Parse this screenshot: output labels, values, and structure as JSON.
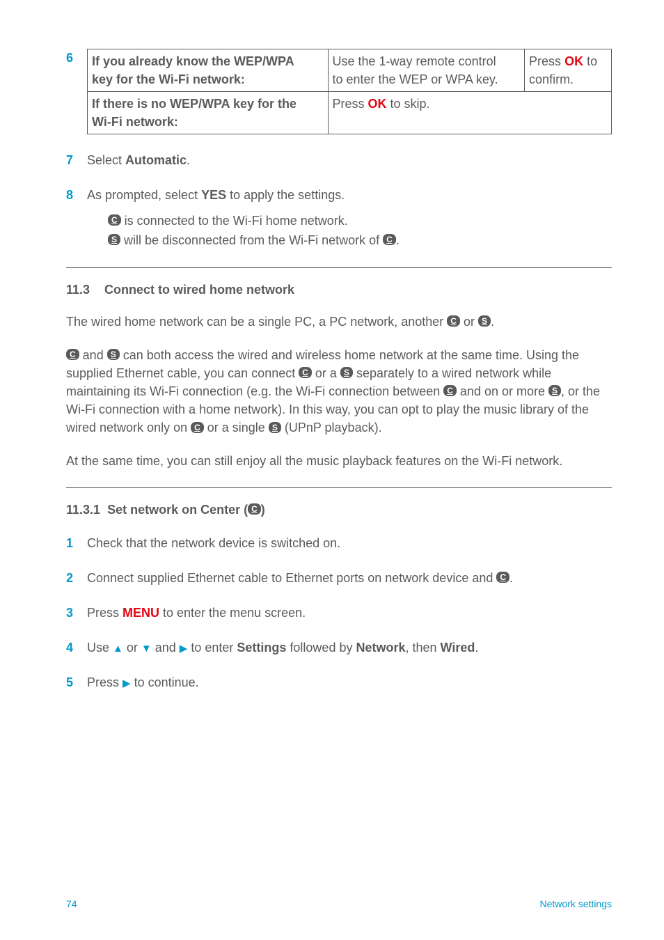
{
  "step6": {
    "num": "6",
    "row1c1a": "If you already know the WEP/WPA",
    "row1c1b": "key for the Wi-Fi network:",
    "row1c2a": "Use the 1-way remote control",
    "row1c2b": "to enter the WEP or WPA key.",
    "row1c3a": "Press ",
    "row1c3ok": "OK",
    "row1c3b": " to",
    "row1c3c": "confirm.",
    "row2c1a": "If there is no WEP/WPA key for the",
    "row2c1b": "Wi-Fi network:",
    "row2c2a": "Press ",
    "row2c2ok": "OK",
    "row2c2b": " to skip."
  },
  "step7": {
    "num": "7",
    "a": "Select ",
    "b": "Automatic",
    "c": "."
  },
  "step8": {
    "num": "8",
    "a": "As prompted, select ",
    "b": "YES",
    "c": " to apply the settings.",
    "line1a": " is connected to the Wi-Fi home network.",
    "line2a": " will be disconnected from the Wi-Fi network of ",
    "line2b": "."
  },
  "sec113": {
    "num": "11.3",
    "title": "Connect to wired home network"
  },
  "p1": {
    "a": "The wired home network can be a single PC, a PC network, another ",
    "b": " or ",
    "c": "."
  },
  "p2": {
    "a": " and ",
    "b": " can both access the wired and wireless home network at the same time. Using the supplied Ethernet cable, you can connect ",
    "c": " or a ",
    "d": " separately to a wired network while maintaining its Wi-Fi connection (e.g. the Wi-Fi connection between ",
    "e": " and on or more ",
    "f": ", or the Wi-Fi connection with a home network). In this way, you can opt to play the music library of the wired network only on ",
    "g": " or a single ",
    "h": " (UPnP playback)."
  },
  "p3": "At the same time, you can still enjoy all the music playback features on the Wi-Fi network.",
  "sec1131": {
    "num": "11.3.1",
    "a": "Set network on Center (",
    "b": ")"
  },
  "s1": {
    "num": "1",
    "t": "Check that the network device is switched on."
  },
  "s2": {
    "num": "2",
    "a": "Connect supplied Ethernet cable to Ethernet ports on network device and ",
    "b": "."
  },
  "s3": {
    "num": "3",
    "a": "Press ",
    "menu": "MENU",
    "b": " to enter the menu screen."
  },
  "s4": {
    "num": "4",
    "a": "Use ",
    "b": " or ",
    "c": " and ",
    "d": " to enter ",
    "e": "Settings",
    "f": " followed by ",
    "g": "Network",
    "h": ", then ",
    "i": "Wired",
    "j": "."
  },
  "s5": {
    "num": "5",
    "a": "Press ",
    "b": " to continue."
  },
  "footer": {
    "page": "74",
    "label": "Network settings"
  },
  "glyph": {
    "C": "C",
    "S": "S"
  }
}
